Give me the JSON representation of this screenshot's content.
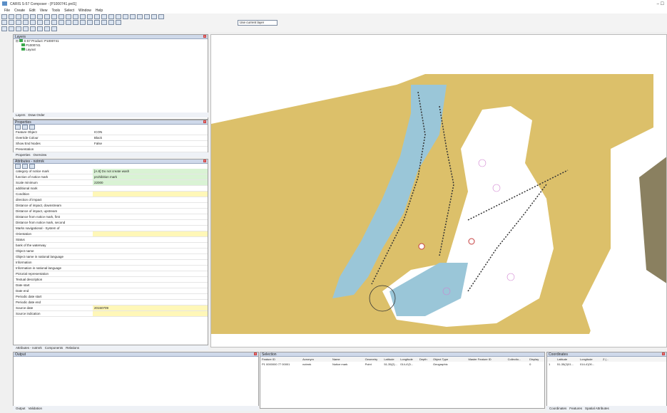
{
  "window": {
    "title": "CARIS S-57 Composer - [P1000741.prd1]",
    "controls": "–   ☐"
  },
  "menu": [
    "File",
    "Create",
    "Edit",
    "View",
    "Tools",
    "Select",
    "Window",
    "Help"
  ],
  "toolbar": {
    "layer_select": "Use current layer"
  },
  "layers": {
    "title": "Layers",
    "tree": [
      "S-57 Product: P1000741",
      "P1000741",
      "Layout"
    ],
    "tabs": [
      "Layers",
      "Draw Order"
    ]
  },
  "properties": {
    "title": "Properties",
    "rows": [
      {
        "k": "Feature Object",
        "v": "ICON"
      },
      {
        "k": "Override Colour",
        "v": "Black"
      },
      {
        "k": "Show End Nodes",
        "v": "False"
      },
      {
        "k": "Presentation",
        "v": ""
      }
    ],
    "tabs": [
      "Properties",
      "Overview"
    ]
  },
  "attributes": {
    "title": "Attributes - notmrk",
    "rows": [
      {
        "k": "category of notice mark",
        "v": "[A.8] Do not create wash",
        "hl": "green"
      },
      {
        "k": "function of notice mark",
        "v": "prohibition mark",
        "hl": "green"
      },
      {
        "k": "Scale minimum",
        "v": "22000",
        "hl": "green"
      },
      {
        "k": "additional mark",
        "v": "",
        "hl": ""
      },
      {
        "k": "Condition",
        "v": "",
        "hl": "yellow"
      },
      {
        "k": "direction of impact",
        "v": "",
        "hl": ""
      },
      {
        "k": "Distance of impact, downstream",
        "v": "",
        "hl": ""
      },
      {
        "k": "Distance of impact, upstream",
        "v": "",
        "hl": ""
      },
      {
        "k": "Distance from notice mark, first",
        "v": "",
        "hl": ""
      },
      {
        "k": "Distance from notice mark, second",
        "v": "",
        "hl": ""
      },
      {
        "k": "Marks navigational - System of",
        "v": "",
        "hl": ""
      },
      {
        "k": "Orientation",
        "v": "",
        "hl": "yellow"
      },
      {
        "k": "Status",
        "v": "",
        "hl": ""
      },
      {
        "k": "bank of the waterway",
        "v": "",
        "hl": ""
      },
      {
        "k": "Object name",
        "v": "",
        "hl": ""
      },
      {
        "k": "Object name in national language",
        "v": "",
        "hl": ""
      },
      {
        "k": "Information",
        "v": "",
        "hl": ""
      },
      {
        "k": "Information in national language",
        "v": "",
        "hl": ""
      },
      {
        "k": "Pictorial representation",
        "v": "",
        "hl": ""
      },
      {
        "k": "Textual description",
        "v": "",
        "hl": ""
      },
      {
        "k": "Date start",
        "v": "",
        "hl": ""
      },
      {
        "k": "Date end",
        "v": "",
        "hl": ""
      },
      {
        "k": "Periodic date start",
        "v": "",
        "hl": ""
      },
      {
        "k": "Periodic date end",
        "v": "",
        "hl": ""
      },
      {
        "k": "Source date",
        "v": "20150709",
        "hl": "yellow"
      },
      {
        "k": "Source indication",
        "v": "",
        "hl": "yellow"
      }
    ],
    "tabs": [
      "Attributes - notmrk",
      "Components",
      "Relations"
    ]
  },
  "output": {
    "title": "Output",
    "tabs": [
      "Output",
      "Validation"
    ]
  },
  "selection": {
    "title": "Selection",
    "columns": [
      "Feature ID",
      "Acronym",
      "Name",
      "Geometry",
      "Latitude",
      "Longitude",
      "Depth",
      "Object Type",
      "Master Feature ID",
      "Collectio...",
      "Display"
    ],
    "rows": [
      [
        "P1 0000000 77 00001",
        "notmrk",
        "Notice mark",
        "Point",
        "51-35(2)...",
        "014-4'(5...",
        "",
        "Geographic",
        "",
        "",
        "0"
      ]
    ]
  },
  "coordinates": {
    "title": "Coordinates",
    "columns": [
      "",
      "Latitude",
      "Longitude",
      "Z (..."
    ],
    "rows": [
      [
        "1",
        "51-35(2)01...",
        "014-4'(00...",
        ""
      ]
    ],
    "tabs": [
      "Coordinates",
      "Features",
      "Spatial Attributes"
    ]
  },
  "colors": {
    "land": "#dcc06a",
    "water": "#9ac6d8",
    "white": "#ffffff",
    "accent": "#c43c3c"
  }
}
